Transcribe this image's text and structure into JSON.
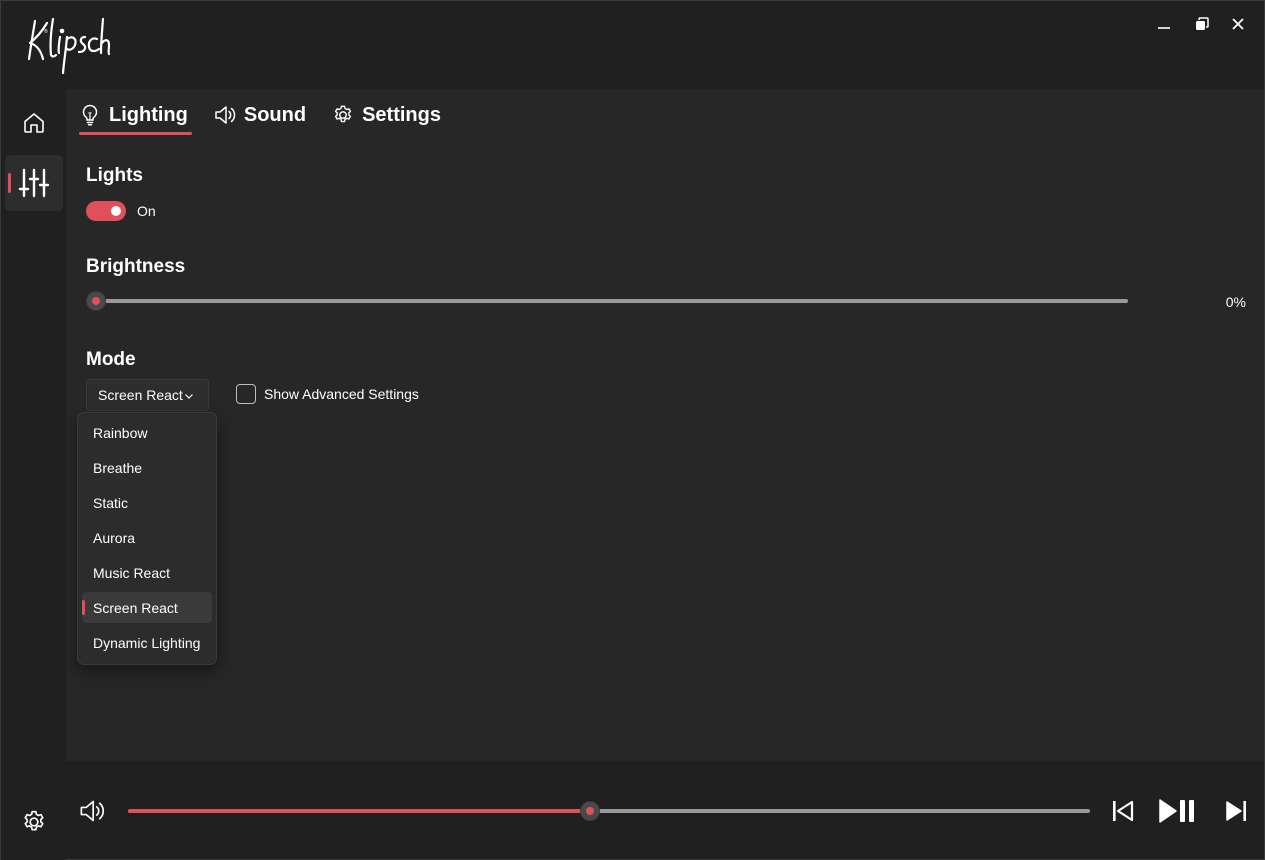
{
  "app": {
    "logo_text": "Klipsch",
    "window_controls": [
      "minimize",
      "restore",
      "close"
    ]
  },
  "rail": {
    "items": [
      {
        "name": "home",
        "icon": "home-icon"
      },
      {
        "name": "equalizer",
        "icon": "sliders-icon",
        "active": true
      }
    ],
    "footer_icon": "gear-icon"
  },
  "tabs": [
    {
      "label": "Lighting",
      "icon": "lightbulb-icon",
      "active": true
    },
    {
      "label": "Sound",
      "icon": "speaker-icon"
    },
    {
      "label": "Settings",
      "icon": "gear-icon"
    }
  ],
  "lights": {
    "title": "Lights",
    "toggle_state": "On",
    "enabled": true
  },
  "brightness": {
    "title": "Brightness",
    "value_label": "0%",
    "value": 0
  },
  "mode": {
    "title": "Mode",
    "selected": "Screen React",
    "options": [
      "Rainbow",
      "Breathe",
      "Static",
      "Aurora",
      "Music React",
      "Screen React",
      "Dynamic Lighting"
    ],
    "advanced_label": "Show Advanced Settings",
    "advanced_checked": false
  },
  "player": {
    "volume_fraction": 0.48,
    "controls": [
      "previous-track",
      "play-pause",
      "next-track"
    ]
  },
  "colors": {
    "accent": "#e0505a",
    "background": "#202020",
    "panel": "#272727"
  }
}
